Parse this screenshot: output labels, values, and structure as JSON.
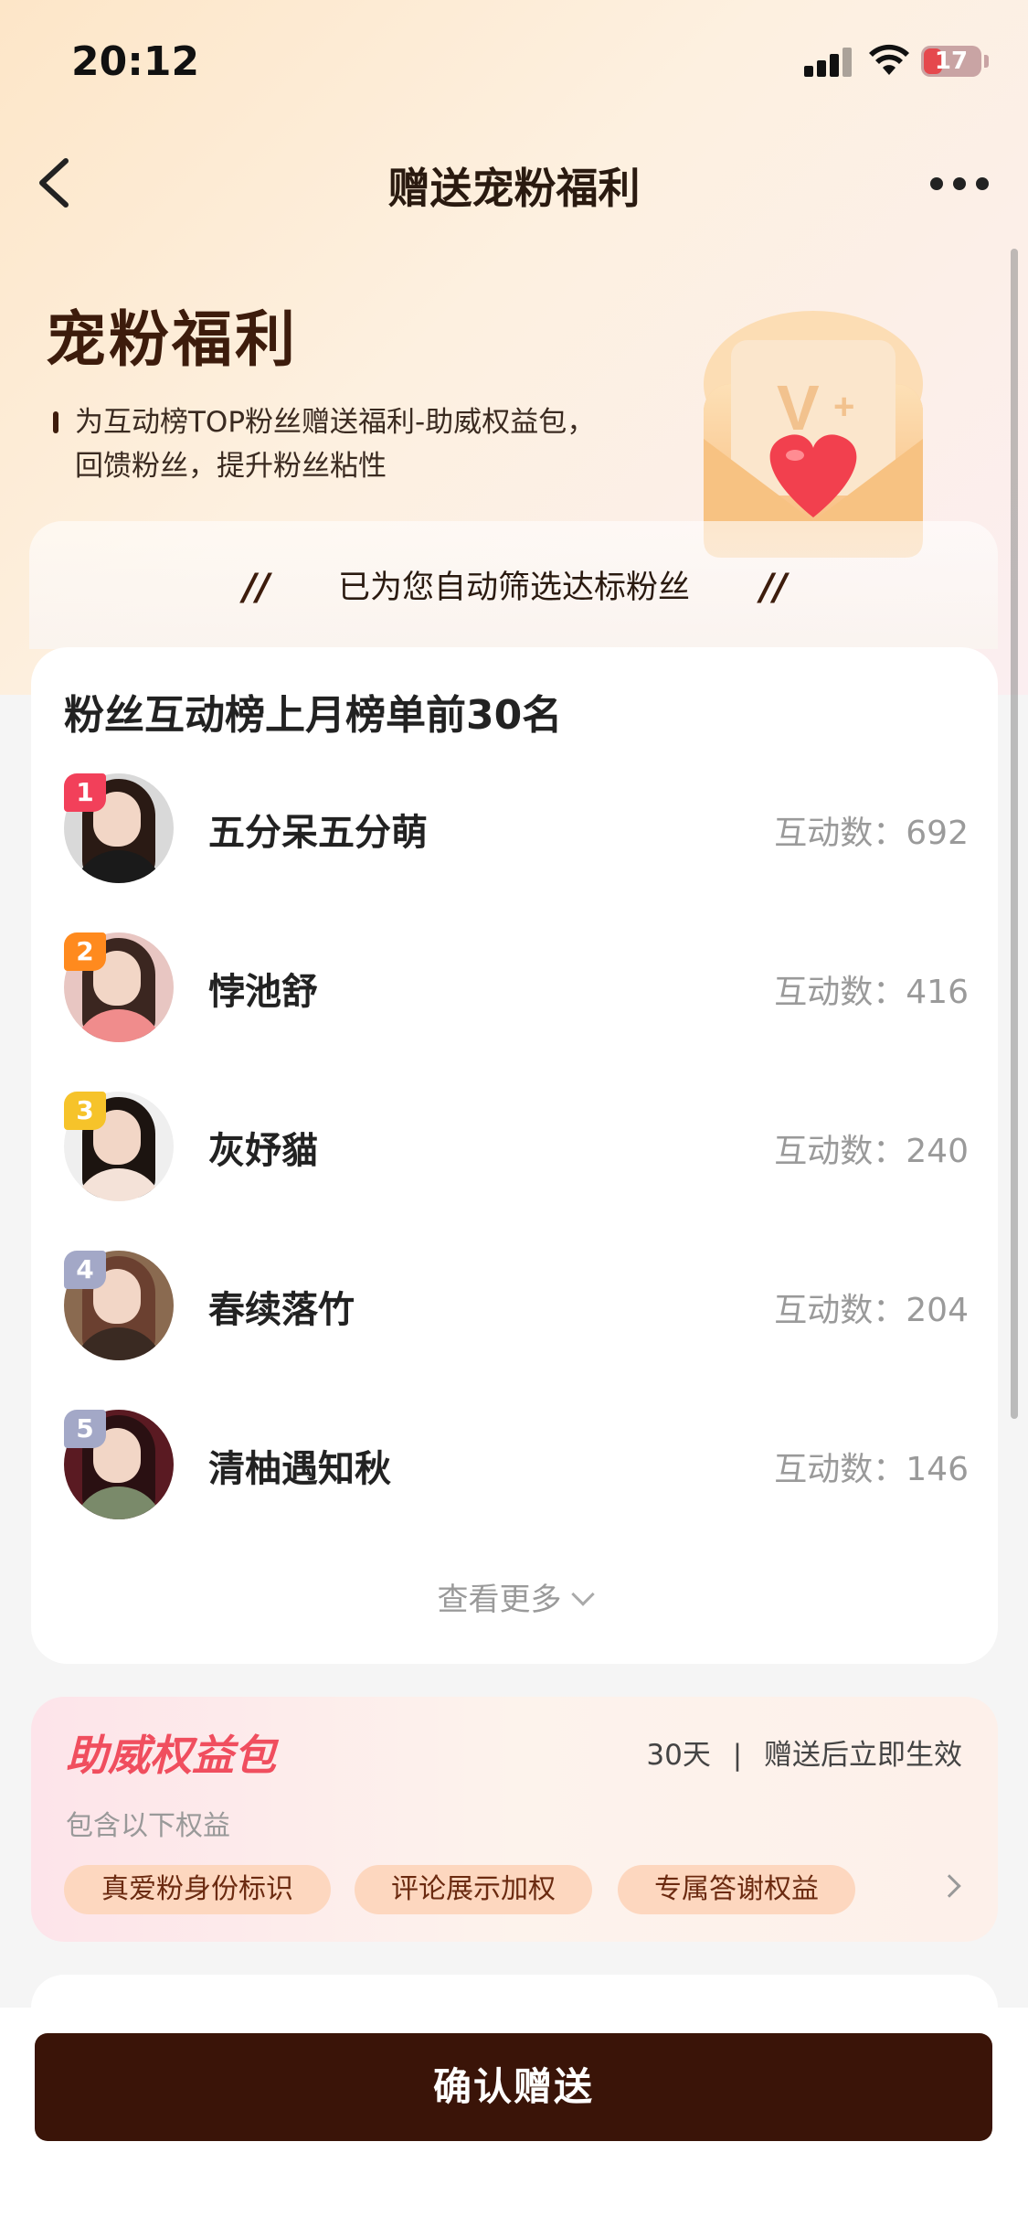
{
  "status": {
    "time": "20:12",
    "battery": "17"
  },
  "nav": {
    "title": "赠送宠粉福利"
  },
  "hero": {
    "title": "宠粉福利",
    "desc_line1": "为互动榜TOP粉丝赠送福利-助威权益包，",
    "desc_line2": "回馈粉丝，提升粉丝粘性"
  },
  "filter": {
    "text": "已为您自动筛选达标粉丝"
  },
  "ranking": {
    "title": "粉丝互动榜上月榜单前30名",
    "count_label": "互动数：",
    "fans": [
      {
        "rank": "1",
        "name": "五分呆五分萌",
        "count": "692",
        "badge_color": "#f2405a"
      },
      {
        "rank": "2",
        "name": "悖池舒",
        "count": "416",
        "badge_color": "#ff8a1e"
      },
      {
        "rank": "3",
        "name": "灰妤貓",
        "count": "240",
        "badge_color": "#f6c32a"
      },
      {
        "rank": "4",
        "name": "春续落竹",
        "count": "204",
        "badge_color": "#a3a8c7"
      },
      {
        "rank": "5",
        "name": "清柚遇知秋",
        "count": "146",
        "badge_color": "#a3a8c7"
      }
    ],
    "see_more": "查看更多"
  },
  "pack": {
    "title": "助威权益包",
    "duration": "30天",
    "effect": "赠送后立即生效",
    "subtitle": "包含以下权益",
    "benefits": [
      "真爱粉身份标识",
      "评论展示加权",
      "专属答谢权益"
    ]
  },
  "footer": {
    "confirm": "确认赠送"
  },
  "colors": {
    "primary_dark": "#3a1408",
    "accent_red": "#f04e5e",
    "pill_bg": "#fdd7bf"
  }
}
